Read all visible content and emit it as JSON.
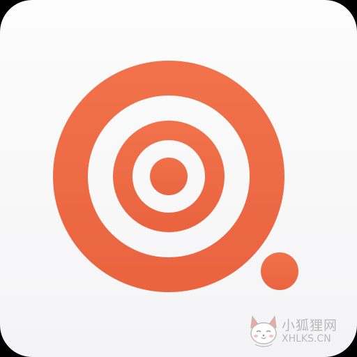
{
  "app_icon": {
    "background_color": "#F6F6F7",
    "accent_color": "#EE6A44",
    "glyph": "target-rings-icon"
  },
  "watermark": {
    "text_cn": "小狐狸网",
    "text_en": "XHLKS.CN",
    "mascot": "fox-mascot-icon"
  }
}
